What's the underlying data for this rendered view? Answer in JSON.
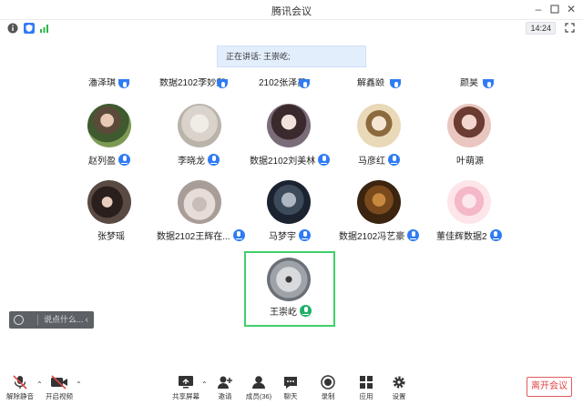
{
  "window": {
    "title": "腾讯会议"
  },
  "status": {
    "time": "14:24"
  },
  "speaking": {
    "text": "正在讲话: 王崇屹;"
  },
  "partial_row": [
    "潘泽琪",
    "数据2102李妙然",
    "2102张泽鑫",
    "解鑫颐",
    "颜昊"
  ],
  "row1": [
    {
      "name": "赵列盈"
    },
    {
      "name": "李晓龙"
    },
    {
      "name": "数据2102刘美林"
    },
    {
      "name": "马彦红"
    },
    {
      "name": "叶萌源"
    }
  ],
  "row2": [
    {
      "name": "张梦瑶"
    },
    {
      "name": "数据2102王辉在..."
    },
    {
      "name": "马梦宇"
    },
    {
      "name": "数据2102冯艺豪"
    },
    {
      "name": "董佳辉数据2"
    }
  ],
  "active": {
    "name": "王崇屹"
  },
  "chat": {
    "placeholder": "说点什么..."
  },
  "toolbar": {
    "unmute": "解除静音",
    "video": "开启视频",
    "share": "共享屏幕",
    "invite": "邀请",
    "members": "成员(36)",
    "chat": "聊天",
    "record": "录制",
    "apps": "应用",
    "settings": "设置",
    "leave": "离开会议"
  },
  "colors": {
    "accent": "#2f7bf5",
    "active_border": "#3fcf6b",
    "leave": "#e24646"
  }
}
